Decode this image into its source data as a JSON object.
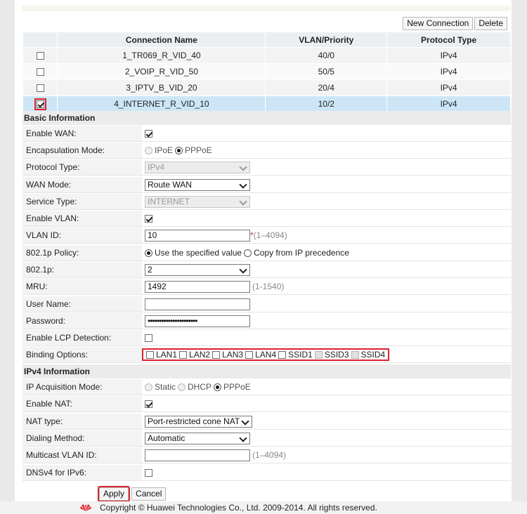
{
  "toolbar": {
    "new_connection": "New Connection",
    "delete": "Delete"
  },
  "connections": {
    "headers": [
      "Connection Name",
      "VLAN/Priority",
      "Protocol Type"
    ],
    "rows": [
      {
        "name": "1_TR069_R_VID_40",
        "vlan": "40/0",
        "protocol": "IPv4",
        "checked": false
      },
      {
        "name": "2_VOIP_R_VID_50",
        "vlan": "50/5",
        "protocol": "IPv4",
        "checked": false
      },
      {
        "name": "3_IPTV_B_VID_20",
        "vlan": "20/4",
        "protocol": "IPv4",
        "checked": false
      },
      {
        "name": "4_INTERNET_R_VID_10",
        "vlan": "10/2",
        "protocol": "IPv4",
        "checked": true
      }
    ]
  },
  "basic": {
    "title": "Basic Information",
    "enable_wan": "Enable WAN:",
    "encapsulation_mode": "Encapsulation Mode:",
    "encap_ipoe": "IPoE",
    "encap_pppoe": "PPPoE",
    "protocol_type": "Protocol Type:",
    "protocol_value": "IPv4",
    "wan_mode": "WAN Mode:",
    "wan_mode_value": "Route WAN",
    "service_type": "Service Type:",
    "service_value": "INTERNET",
    "enable_vlan": "Enable VLAN:",
    "vlan_id": "VLAN ID:",
    "vlan_id_value": "10",
    "vlan_req": "*",
    "vlan_hint": "(1–4094)",
    "policy": "802.1p Policy:",
    "policy_specified": "Use the specified value",
    "policy_copy": "Copy from IP precedence",
    "p8021": "802.1p:",
    "p8021_value": "2",
    "mru": "MRU:",
    "mru_value": "1492",
    "mru_hint": "(1-1540)",
    "user_name": "User Name:",
    "user_name_value": "",
    "password": "Password:",
    "password_value": "••••••••••••••••••••••",
    "lcp": "Enable LCP Detection:",
    "binding": "Binding Options:",
    "binding_items": [
      "LAN1",
      "LAN2",
      "LAN3",
      "LAN4",
      "SSID1",
      "SSID3",
      "SSID4"
    ]
  },
  "ipv4": {
    "title": "IPv4 Information",
    "acq_mode": "IP Acquisition Mode:",
    "acq_static": "Static",
    "acq_dhcp": "DHCP",
    "acq_pppoe": "PPPoE",
    "enable_nat": "Enable NAT:",
    "nat_type": "NAT type:",
    "nat_type_value": "Port-restricted cone NAT",
    "dialing": "Dialing Method:",
    "dialing_value": "Automatic",
    "multicast_vlan": "Multicast VLAN ID:",
    "multicast_hint": "(1–4094)",
    "dnsv4": "DNSv4 for IPv6:"
  },
  "actions": {
    "apply": "Apply",
    "cancel": "Cancel"
  },
  "footer": {
    "copyright": "Copyright © Huawei Technologies Co., Ltd. 2009-2014. All rights reserved."
  },
  "colors": {
    "selected_row": "#cde6f7",
    "highlight_red": "#d8242f",
    "brand_red": "#e0232e"
  }
}
